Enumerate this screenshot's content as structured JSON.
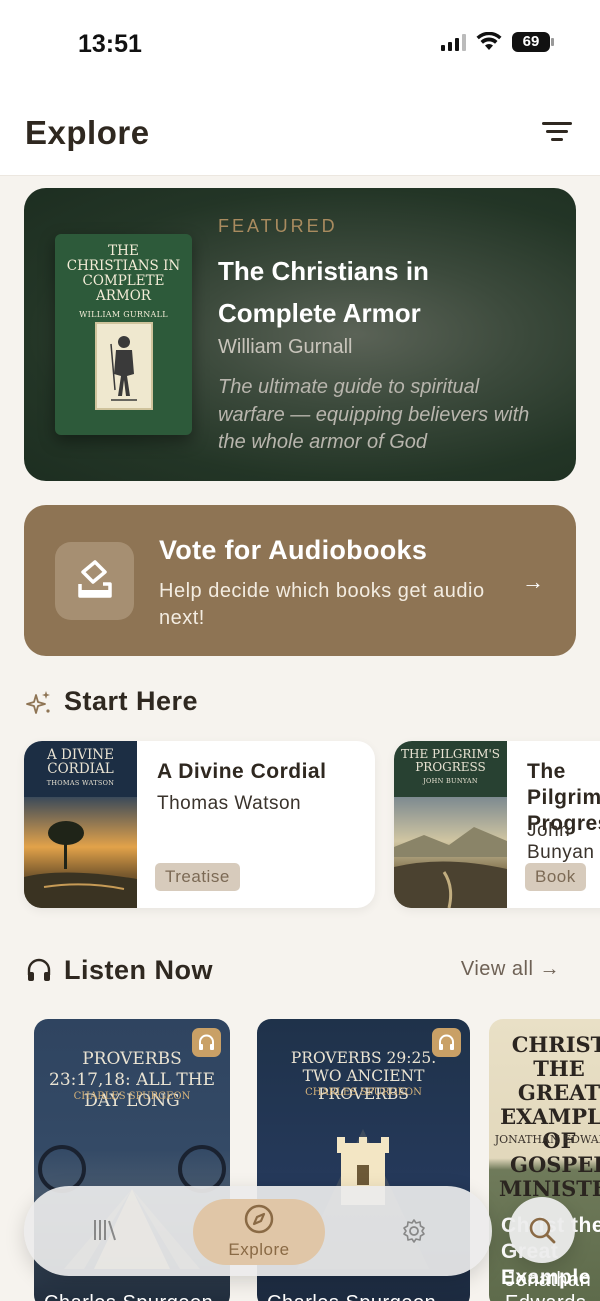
{
  "status_bar": {
    "time": "13:51",
    "battery": "69"
  },
  "header": {
    "title": "Explore"
  },
  "featured": {
    "kicker": "FEATURED",
    "title": "The Christians in Complete Armor",
    "author": "William Gurnall",
    "description": "The ultimate guide to spiritual warfare — equipping believers with the whole armor of God",
    "cover_title": "THE CHRISTIANS IN COMPLETE ARMOR",
    "cover_author": "WILLIAM GURNALL"
  },
  "vote": {
    "title": "Vote for Audiobooks",
    "subtitle": "Help decide which books get audio next!",
    "arrow": "→"
  },
  "start_here": {
    "title": "Start Here",
    "items": [
      {
        "title": "A Divine Cordial",
        "author": "Thomas Watson",
        "tag": "Treatise",
        "cover_title": "A DIVINE CORDIAL",
        "cover_author": "THOMAS WATSON"
      },
      {
        "title": "The Pilgrim's Progress",
        "author": "John Bunyan",
        "tag": "Book",
        "cover_title": "THE PILGRIM'S PROGRESS",
        "cover_author": "JOHN BUNYAN"
      }
    ]
  },
  "listen_now": {
    "title": "Listen Now",
    "view_all": "View all →",
    "items": [
      {
        "cover_title": "PROVERBS 23:17,18: ALL THE DAY LONG",
        "cover_author": "CHARLES SPURGEON",
        "author": "Charles Spurgeon"
      },
      {
        "cover_title": "PROVERBS 29:25. TWO ANCIENT PROVERBS",
        "cover_author": "CHARLES SPURGEON",
        "author": "Charles Spurgeon"
      },
      {
        "cover_title": "CHRIST THE GREAT EXAMPLE OF GOSPEL MINISTERS",
        "cover_author": "JONATHAN EDWARDS",
        "overlay_title": "Christ the Great Example",
        "author": "Jonathan Edwards"
      }
    ]
  },
  "tab_bar": {
    "explore_label": "Explore"
  },
  "colors": {
    "accent": "#8e7454",
    "featured_bg": "#233526",
    "tag_bg": "#d7cbbc"
  }
}
